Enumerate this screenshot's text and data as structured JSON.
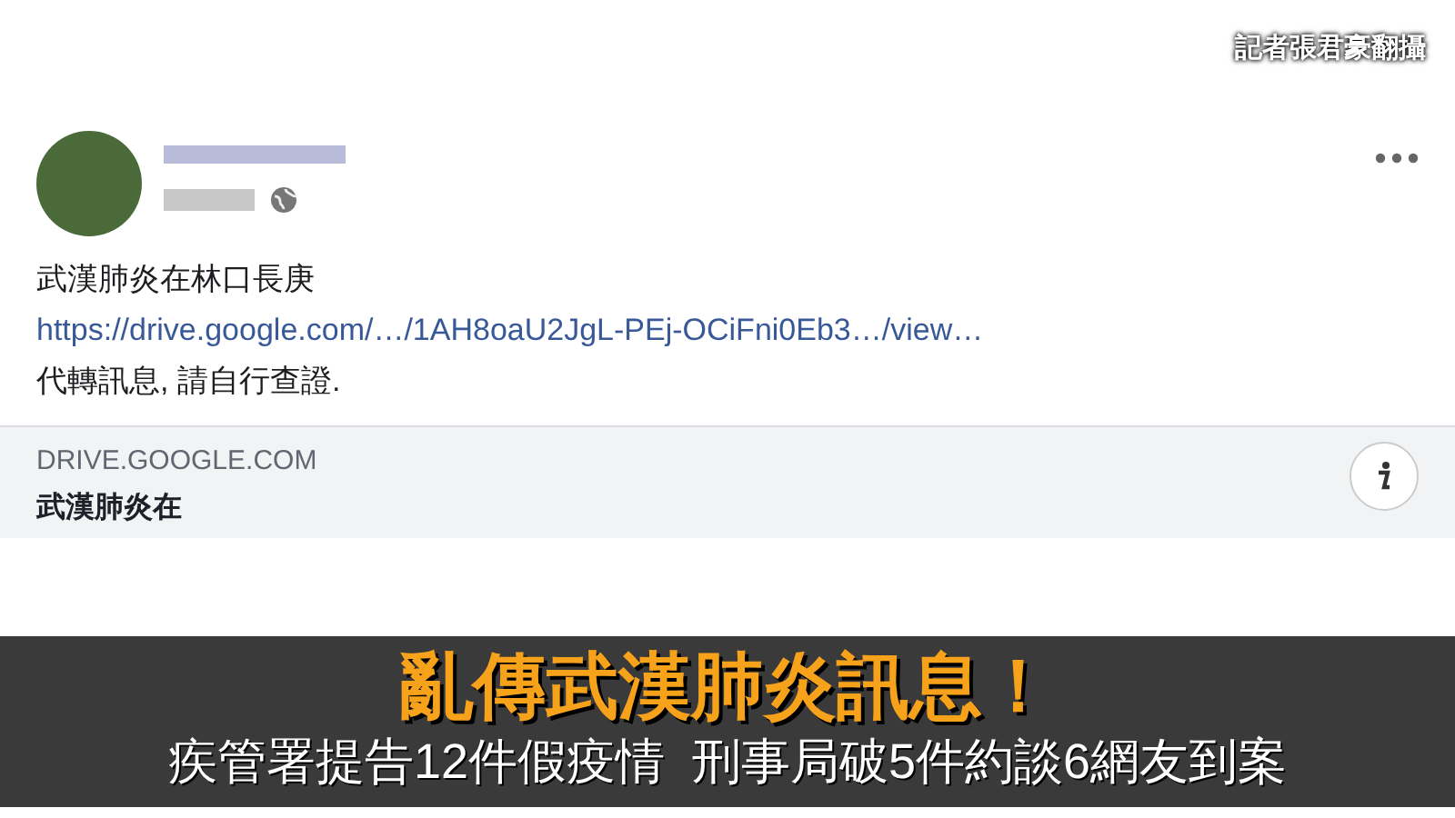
{
  "credit": "記者張君豪翻攝",
  "post": {
    "message": "武漢肺炎在林口長庚",
    "link": "https://drive.google.com/…/1AH8oaU2JgL-PEj-OCiFni0Eb3…/view…",
    "note": "代轉訊息, 請自行查證."
  },
  "preview": {
    "domain": "DRIVE.GOOGLE.COM",
    "title": "武漢肺炎在"
  },
  "banner": {
    "headline": "亂傳武漢肺炎訊息！",
    "subtitle": "疾管署提告12件假疫情  刑事局破5件約談6網友到案"
  }
}
